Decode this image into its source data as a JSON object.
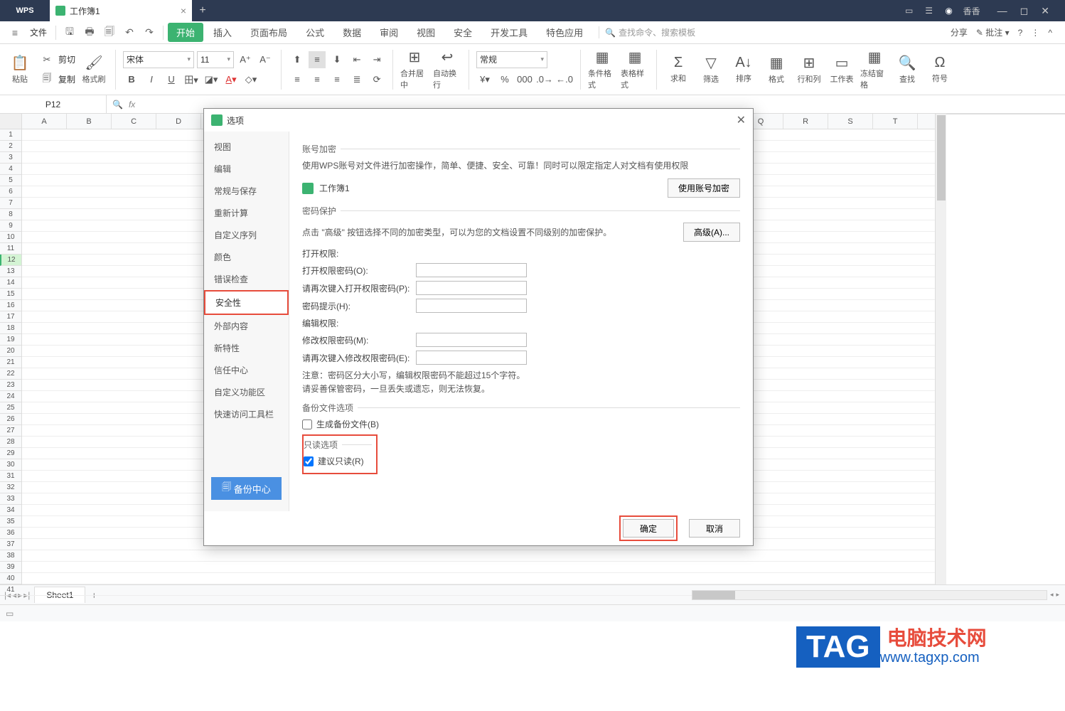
{
  "titlebar": {
    "app": "WPS",
    "doc_name": "工作簿1",
    "user": "香香"
  },
  "menubar": {
    "file": "文件",
    "tabs": [
      "开始",
      "插入",
      "页面布局",
      "公式",
      "数据",
      "审阅",
      "视图",
      "安全",
      "开发工具",
      "特色应用"
    ],
    "active_tab_index": 0,
    "search_placeholder": "查找命令、搜索模板",
    "share": "分享",
    "comment": "批注"
  },
  "ribbon": {
    "paste": "粘贴",
    "cut": "剪切",
    "copy": "复制",
    "format_painter": "格式刷",
    "font_name": "宋体",
    "font_size": "11",
    "merge": "合并居中",
    "wrap": "自动换行",
    "number_format": "常规",
    "cond_format": "条件格式",
    "cell_style": "表格样式",
    "sum": "求和",
    "filter": "筛选",
    "sort": "排序",
    "format": "格式",
    "rowcol": "行和列",
    "worksheet": "工作表",
    "freeze": "冻结窗格",
    "find": "查找",
    "symbol": "符号"
  },
  "formula_bar": {
    "name_box": "P12"
  },
  "columns": [
    "A",
    "B",
    "C",
    "D",
    "",
    "",
    "",
    "",
    "",
    "",
    "",
    "",
    "",
    "",
    "",
    "",
    "Q",
    "R",
    "S",
    "T"
  ],
  "rows_visible": 41,
  "selected_row": 12,
  "sheet_tabs": {
    "active": "Sheet1"
  },
  "dialog": {
    "title": "选项",
    "sidebar": [
      "视图",
      "编辑",
      "常规与保存",
      "重新计算",
      "自定义序列",
      "颜色",
      "错误检查",
      "安全性",
      "外部内容",
      "新特性",
      "信任中心",
      "自定义功能区",
      "快速访问工具栏"
    ],
    "sidebar_active_index": 7,
    "backup_btn": "备份中心",
    "account_encrypt": {
      "title": "账号加密",
      "desc": "使用WPS账号对文件进行加密操作，简单、便捷、安全、可靠！同时可以限定指定人对文档有使用权限",
      "doc": "工作簿1",
      "btn": "使用账号加密"
    },
    "password_protect": {
      "title": "密码保护",
      "desc": "点击 \"高级\" 按钮选择不同的加密类型，可以为您的文档设置不同级别的加密保护。",
      "advanced": "高级(A)..."
    },
    "open_perm": {
      "title": "打开权限:",
      "pwd_label": "打开权限密码(O):",
      "pwd_confirm": "请再次键入打开权限密码(P):",
      "pwd_hint": "密码提示(H):"
    },
    "edit_perm": {
      "title": "编辑权限:",
      "pwd_label": "修改权限密码(M):",
      "pwd_confirm": "请再次键入修改权限密码(E):",
      "note1": "注意：密码区分大小写，编辑权限密码不能超过15个字符。",
      "note2": "请妥善保管密码，一旦丢失或遗忘，则无法恢复。"
    },
    "backup_opts": {
      "title": "备份文件选项",
      "gen_backup": "生成备份文件(B)"
    },
    "readonly": {
      "title": "只读选项",
      "suggest": "建议只读(R)",
      "checked": true
    },
    "ok": "确定",
    "cancel": "取消"
  },
  "watermark": {
    "tag": "TAG",
    "title": "电脑技术网",
    "url": "www.tagxp.com"
  }
}
